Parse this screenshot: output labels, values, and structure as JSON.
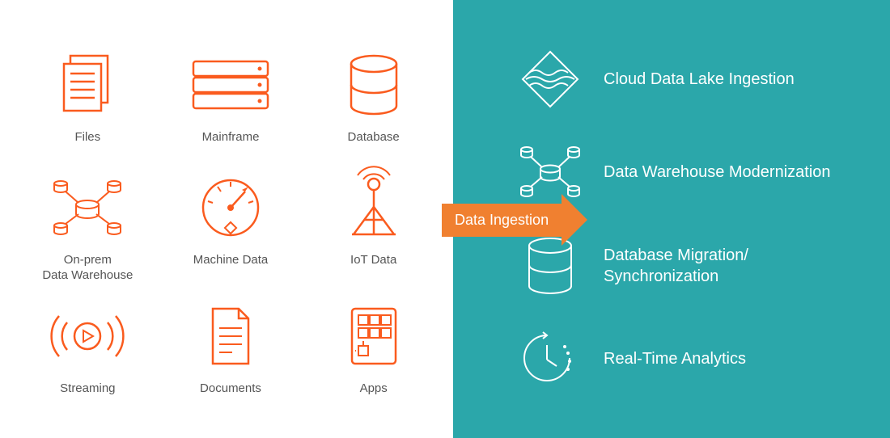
{
  "arrow_label": "Data Ingestion",
  "sources": [
    {
      "label": "Files",
      "icon": "files-icon"
    },
    {
      "label": "Mainframe",
      "icon": "mainframe-icon"
    },
    {
      "label": "Database",
      "icon": "database-icon"
    },
    {
      "label": "On-prem\nData Warehouse",
      "icon": "data-warehouse-icon"
    },
    {
      "label": "Machine Data",
      "icon": "machine-data-icon"
    },
    {
      "label": "IoT Data",
      "icon": "iot-icon"
    },
    {
      "label": "Streaming",
      "icon": "streaming-icon"
    },
    {
      "label": "Documents",
      "icon": "documents-icon"
    },
    {
      "label": "Apps",
      "icon": "apps-icon"
    }
  ],
  "destinations": [
    {
      "label": "Cloud Data Lake Ingestion",
      "icon": "datalake-icon"
    },
    {
      "label": "Data Warehouse Modernization",
      "icon": "dw-modern-icon"
    },
    {
      "label": "Database Migration/ Synchronization",
      "icon": "db-migration-icon"
    },
    {
      "label": "Real-Time Analytics",
      "icon": "realtime-icon"
    }
  ],
  "colors": {
    "orange": "#fa5b1e",
    "teal": "#2ba7aa",
    "arrow": "#f08030"
  }
}
